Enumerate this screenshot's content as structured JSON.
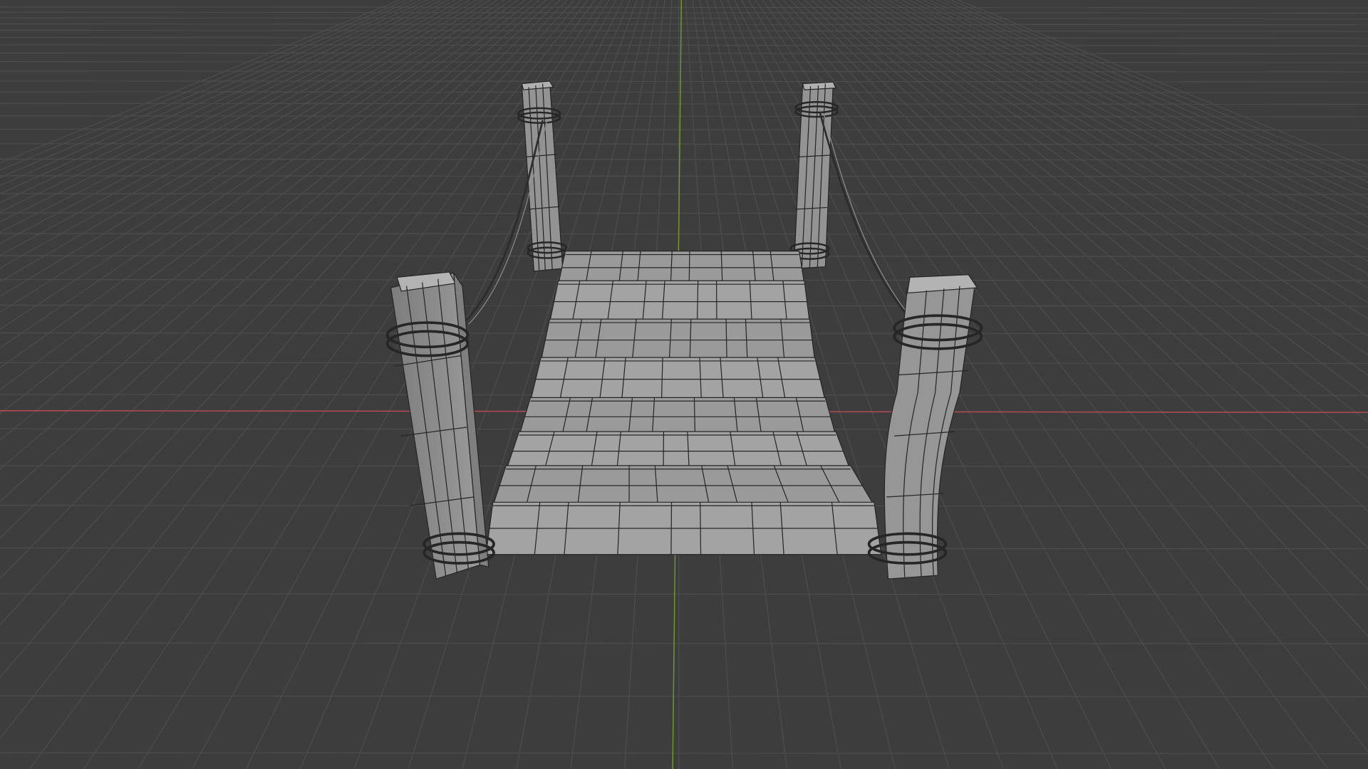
{
  "viewport": {
    "background": "#3d3d3d",
    "grid_color": "#4d4d4d",
    "x_axis_color": "#b84b55",
    "y_axis_color": "#6f9a2a",
    "shading": "solid",
    "overlay": "wireframe"
  },
  "object": {
    "name_shown": "",
    "parts": [
      "bridge-deck",
      "front-left-post",
      "front-right-post",
      "back-left-post",
      "back-right-post",
      "left-rope",
      "right-rope"
    ],
    "mesh_color": "#9a9a9a",
    "wire_color": "#2a2a2a"
  }
}
